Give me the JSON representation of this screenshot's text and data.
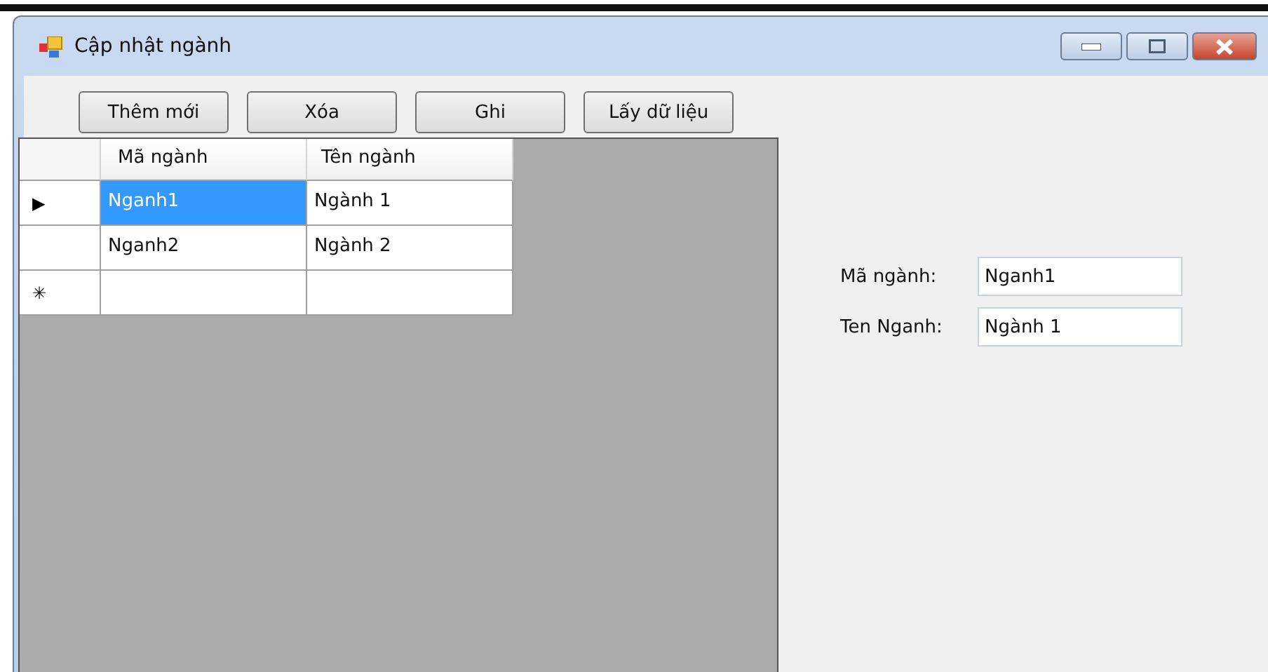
{
  "window": {
    "title": "Cập nhật ngành"
  },
  "toolbar": [
    "Thêm mới",
    "Xóa",
    "Ghi",
    "Lấy dữ liệu"
  ],
  "grid": {
    "columns": [
      "Mã ngành",
      "Tên ngành"
    ],
    "rows": [
      {
        "marker": "▶",
        "cells": [
          {
            "text": "Nganh1",
            "selected": true
          },
          {
            "text": "Ngành 1",
            "selected": false
          }
        ]
      },
      {
        "cells": [
          {
            "text": "Nganh2",
            "selected": false
          },
          {
            "text": "Ngành 2",
            "selected": false
          }
        ]
      },
      {
        "marker": "✳",
        "cells": [
          {
            "text": "",
            "selected": false
          },
          {
            "text": "",
            "selected": false
          }
        ]
      }
    ]
  },
  "form": [
    {
      "label": "Mã ngành:",
      "value": "Nganh1"
    },
    {
      "label": "Ten Nganh:",
      "value": "Ngành 1"
    }
  ]
}
